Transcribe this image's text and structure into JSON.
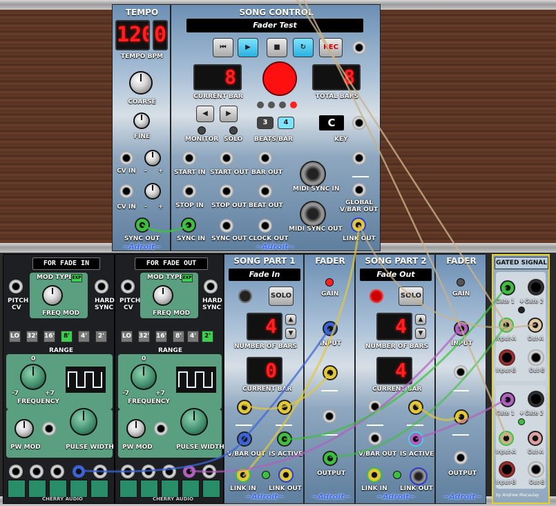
{
  "tempo": {
    "title": "TEMPO",
    "bpm_value": "120",
    "bpm_fraction": "0",
    "bpm_label": "TEMPO BPM",
    "coarse_label": "COARSE",
    "fine_label": "FINE",
    "cv_in_label": "CV IN",
    "minus": "-",
    "plus": "+",
    "sync_out_label": "SYNC OUT",
    "brand": "~Adroit~"
  },
  "song_control": {
    "title": "SONG CONTROL",
    "song_name": "Fader Test",
    "rec_label": "REC",
    "current_bar_value": "8",
    "current_bar_label": "CURRENT BAR",
    "total_bars_value": "8",
    "total_bars_label": "TOTAL BARS",
    "monitor_label": "MONITOR",
    "solo_label": "SOLO",
    "beats_3": "3",
    "beats_4": "4",
    "beats_label": "BEATS/BAR",
    "key_value": "C",
    "key_label": "KEY",
    "start_in": "START IN",
    "start_out": "START OUT",
    "bar_out": "BAR OUT",
    "stop_in": "STOP IN",
    "stop_out": "STOP OUT",
    "beat_out": "BEAT OUT",
    "sync_in": "SYNC IN",
    "sync_out": "SYNC OUT",
    "clock_out": "CLOCK OUT",
    "midi_sync_in": "MIDI SYNC IN",
    "midi_sync_out": "MIDI SYNC OUT",
    "global_vbar_out_1": "GLOBAL",
    "global_vbar_out_2": "V/BAR OUT",
    "link_out": "LINK OUT",
    "brand": "~Adroit~"
  },
  "vco1": {
    "title": "FOR FADE IN",
    "pitch_cv": "PITCH\nCV",
    "pitch_label_1": "PITCH",
    "pitch_label_2": "CV",
    "mod_type": "MOD TYPE",
    "exp": "EXP",
    "freq_mod": "FREQ MOD",
    "hard_sync_1": "HARD",
    "hard_sync_2": "SYNC",
    "range_buttons": [
      "LO",
      "32'",
      "16'",
      "8'",
      "4'",
      "2'"
    ],
    "range_selected": 3,
    "range_label": "RANGE",
    "freq_zero": "0",
    "freq_min": "-7",
    "freq_max": "+7",
    "frequency_label": "FREQUENCY",
    "pw_mod_label": "PW MOD",
    "pulse_width_label": "PULSE WIDTH",
    "brand": "CHERRY AUDIO"
  },
  "vco2": {
    "title": "FOR FADE OUT",
    "pitch_label_1": "PITCH",
    "pitch_label_2": "CV",
    "mod_type": "MOD TYPE",
    "exp": "EXP",
    "freq_mod": "FREQ MOD",
    "hard_sync_1": "HARD",
    "hard_sync_2": "SYNC",
    "range_buttons": [
      "LO",
      "32'",
      "16'",
      "8'",
      "4'",
      "2'"
    ],
    "range_selected": 5,
    "range_label": "RANGE",
    "freq_zero": "0",
    "freq_min": "-7",
    "freq_max": "+7",
    "frequency_label": "FREQUENCY",
    "pw_mod_label": "PW MOD",
    "pulse_width_label": "PULSE WIDTH",
    "brand": "CHERRY AUDIO"
  },
  "song_part1": {
    "title": "SONG PART 1",
    "name": "Fade In",
    "solo": "SOLO",
    "bars_value": "4",
    "bars_label": "NUMBER OF BARS",
    "current_bar_value": "0",
    "current_bar_label": "CURRENT BAR",
    "vbar_out": "V/BAR OUT",
    "is_active": "IS ACTIVE",
    "link_in": "LINK IN",
    "link_out": "LINK OUT",
    "brand": "~Adroit~"
  },
  "fader1": {
    "title": "FADER",
    "gain": "GAIN",
    "input": "INPUT",
    "output": "OUTPUT",
    "brand": "~Adroit~"
  },
  "song_part2": {
    "title": "SONG PART 2",
    "name": "Fade Out",
    "solo": "SOLO",
    "bars_value": "4",
    "bars_label": "NUMBER OF BARS",
    "current_bar_value": "4",
    "current_bar_label": "CURRENT BAR",
    "vbar_out": "V/BAR OUT",
    "is_active": "IS ACTIVE",
    "link_in": "LINK IN",
    "link_out": "LINK OUT",
    "brand": "~Adroit~"
  },
  "fader2": {
    "title": "FADER",
    "gain": "GAIN",
    "input": "INPUT",
    "output": "OUTPUT",
    "brand": "~Adroit~"
  },
  "gated_signal": {
    "title": "GATED SIGNAL",
    "gate1": "Gate 1",
    "gate2": "Gate 2",
    "plus": "+",
    "input_a": "Input-A",
    "out_a": "Out-A",
    "input_b": "Input-B",
    "out_b": "Out-B",
    "brand": "by Andrew Macaulay"
  },
  "colors": {
    "cable_green": "#3fbf3f",
    "cable_yellow": "#e3c73a",
    "cable_blue": "#3b64d6",
    "cable_purple": "#b060c0",
    "cable_tan": "#c9b28a",
    "led_red": "#ff2020"
  }
}
